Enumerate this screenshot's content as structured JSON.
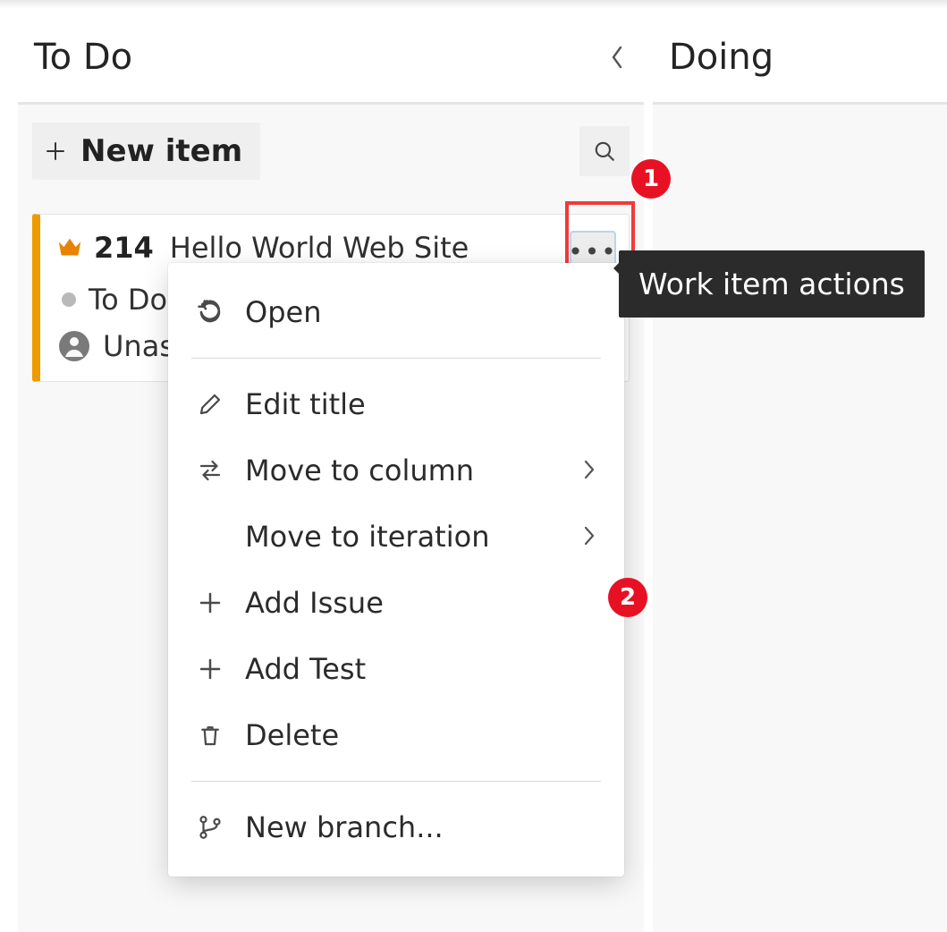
{
  "columns": {
    "todo": {
      "title": "To Do"
    },
    "doing": {
      "title": "Doing"
    }
  },
  "toolbar": {
    "new_item_label": "New item"
  },
  "card": {
    "id": "214",
    "title": "Hello World Web Site",
    "status": "To Do",
    "assignee": "Unassigned"
  },
  "tooltip": {
    "text": "Work item actions"
  },
  "menu": {
    "open": "Open",
    "edit_title": "Edit title",
    "move_column": "Move to column",
    "move_iteration": "Move to iteration",
    "add_issue": "Add Issue",
    "add_test": "Add Test",
    "delete": "Delete",
    "new_branch": "New branch..."
  },
  "callouts": {
    "one": "1",
    "two": "2"
  }
}
